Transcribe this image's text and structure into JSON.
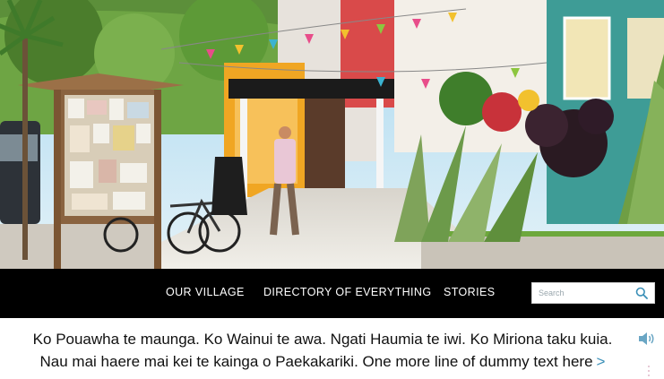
{
  "hero": {
    "description_icon": "street-photo"
  },
  "nav": {
    "items": [
      {
        "label": "OUR VILLAGE"
      },
      {
        "label": "DIRECTORY OF EVERYTHING"
      },
      {
        "label": "STORIES"
      }
    ]
  },
  "search": {
    "placeholder": "Search",
    "icon": "search-icon"
  },
  "welcome": {
    "line1": "Ko Pouawha te maunga. Ko Wainui te awa. Ngati Haumia te iwi. Ko Miriona taku kuia.",
    "line2": "Nau mai haere mai kei te kainga o Paekakariki. One more line of dummy text here",
    "more": ">",
    "audio_icon": "speaker-icon"
  },
  "colors": {
    "navbar": "#000000",
    "link": "#3a8fb7",
    "audio": "#6aa6c4"
  }
}
